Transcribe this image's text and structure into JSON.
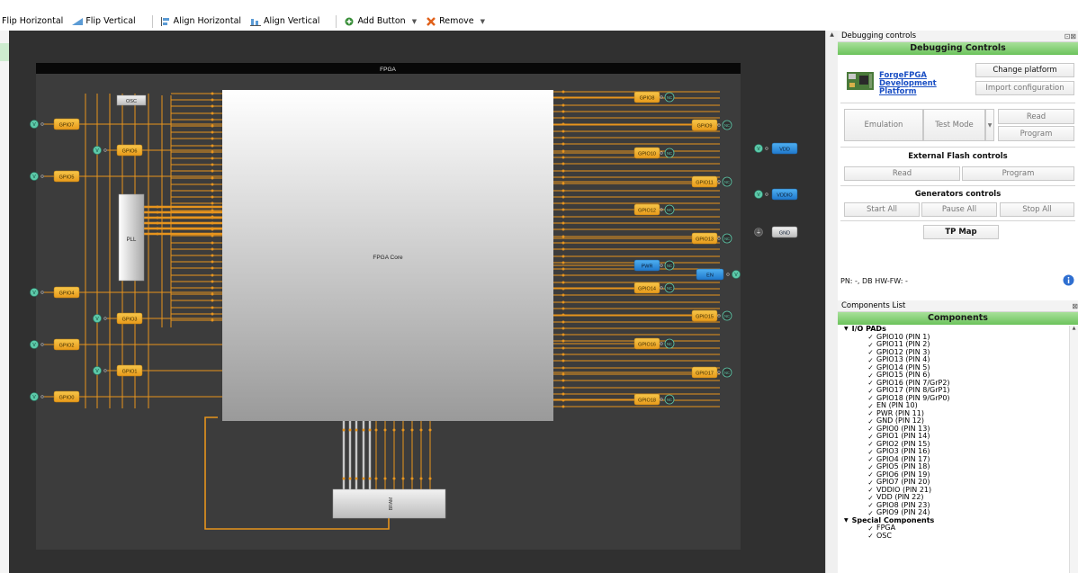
{
  "toolbar": {
    "flip_horizontal": "Flip Horizontal",
    "flip_vertical": "Flip Vertical",
    "align_horizontal": "Align Horizontal",
    "align_vertical": "Align Vertical",
    "add_button": "Add Button",
    "remove": "Remove"
  },
  "canvas": {
    "fpga_title": "FPGA",
    "core_label": "FPGA Core",
    "pll_label": "PLL",
    "osc_label": "OSC",
    "bram_label": "BRAM",
    "v_symbol": "V",
    "nc_symbol": "NC",
    "left_gpios": [
      "GPIO7",
      "GPIO6",
      "GPIO5",
      "GPIO4",
      "GPIO3",
      "GPIO2",
      "GPIO1",
      "GPIO0"
    ],
    "right_gpios": [
      "GPIO8",
      "GPIO9",
      "GPIO10",
      "GPIO11",
      "GPIO12",
      "GPIO13",
      "PWR",
      "GPIO14",
      "GPIO15",
      "GPIO16",
      "GPIO17",
      "GPIO18"
    ],
    "power_pins": [
      "VDD",
      "VDDIO",
      "GND",
      "EN"
    ]
  },
  "debug": {
    "window_title": "Debugging controls",
    "header": "Debugging Controls",
    "platform_link": "ForgeFPGA Development Platform",
    "change_platform": "Change platform",
    "import_config": "Import configuration",
    "emulation": "Emulation",
    "test_mode": "Test Mode",
    "read": "Read",
    "program": "Program",
    "ext_flash_title": "External Flash controls",
    "flash_read": "Read",
    "flash_program": "Program",
    "generators_title": "Generators controls",
    "start_all": "Start All",
    "pause_all": "Pause All",
    "stop_all": "Stop All",
    "tp_map": "TP Map",
    "pn_text": "PN: -, DB HW-FW: -"
  },
  "components": {
    "window_title": "Components List",
    "header": "Components",
    "groups": [
      {
        "label": "I/O PADs",
        "items": [
          "GPIO10 (PIN 1)",
          "GPIO11 (PIN 2)",
          "GPIO12 (PIN 3)",
          "GPIO13 (PIN 4)",
          "GPIO14 (PIN 5)",
          "GPIO15 (PIN 6)",
          "GPIO16 (PIN 7/GrP2)",
          "GPIO17 (PIN 8/GrP1)",
          "GPIO18 (PIN 9/GrP0)",
          "EN (PIN 10)",
          "PWR (PIN 11)",
          "GND (PIN 12)",
          "GPIO0 (PIN 13)",
          "GPIO1 (PIN 14)",
          "GPIO2 (PIN 15)",
          "GPIO3 (PIN 16)",
          "GPIO4 (PIN 17)",
          "GPIO5 (PIN 18)",
          "GPIO6 (PIN 19)",
          "GPIO7 (PIN 20)",
          "VDDIO (PIN 21)",
          "VDD (PIN 22)",
          "GPIO8 (PIN 23)",
          "GPIO9 (PIN 24)"
        ]
      },
      {
        "label": "Special Components",
        "items": [
          "FPGA",
          "OSC"
        ]
      }
    ]
  },
  "colors": {
    "canvas_bg": "#303030",
    "board_bg": "#3c3c3c",
    "wire": "#e7941d",
    "gpio_block": "#f0b030",
    "v_node": "#5cc8a8",
    "blue_pin": "#2f8fe0",
    "green_header": "#78c868"
  }
}
